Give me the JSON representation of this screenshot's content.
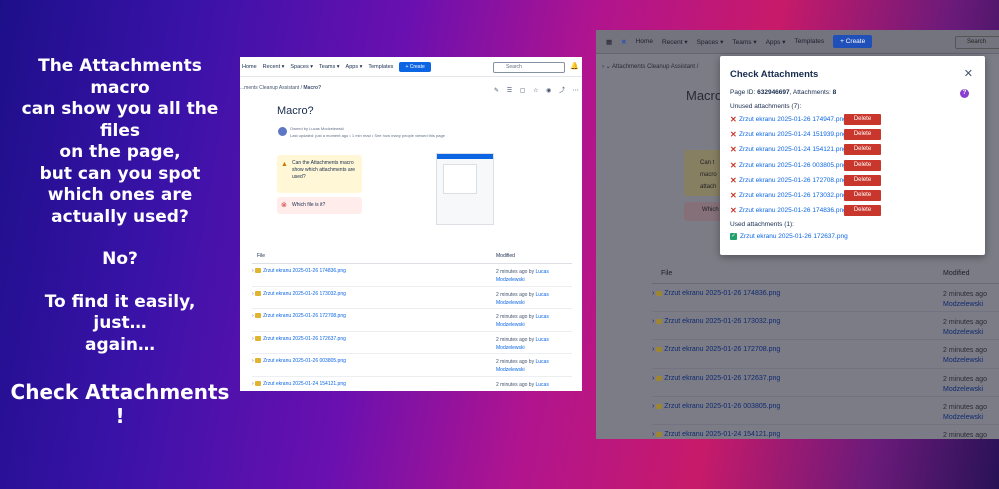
{
  "promo": {
    "lines": [
      "The Attachments macro",
      "can show you all the files",
      "on the page,",
      "but can you spot",
      "which ones are",
      "actually used?",
      "",
      "No?",
      "",
      "To find it easily,",
      "just…",
      "again…"
    ],
    "cta": "Check Attachments !"
  },
  "left": {
    "nav": [
      "Home",
      "Recent ▾",
      "Spaces ▾",
      "Teams ▾",
      "Apps ▾",
      "Templates"
    ],
    "create": "+ Create",
    "search": "Search",
    "breadcrumb_start": "...ments Cleanup Assistant",
    "breadcrumb_page": "Macro?",
    "title": "Macro?",
    "owned": "Owned by Lucas Modzelewski",
    "updated": "Last updated: just a moment ago • 1 min read • See how many people viewed this page",
    "warning": "Can the Attachments macro show which attachments are used?",
    "error": "Which file is it?",
    "col_file": "File",
    "col_modified": "Modified",
    "rows": [
      {
        "file": "Zrzut ekranu 2025-01-26 174836.png",
        "when": "2 minutes ago by",
        "who1": "Lucas",
        "who2": "Modzelewski"
      },
      {
        "file": "Zrzut ekranu 2025-01-26 173032.png",
        "when": "2 minutes ago by",
        "who1": "Lucas",
        "who2": "Modzelewski"
      },
      {
        "file": "Zrzut ekranu 2025-01-26 172708.png",
        "when": "2 minutes ago by",
        "who1": "Lucas",
        "who2": "Modzelewski"
      },
      {
        "file": "Zrzut ekranu 2025-01-26 172637.png",
        "when": "2 minutes ago by",
        "who1": "Lucas",
        "who2": "Modzelewski"
      },
      {
        "file": "Zrzut ekranu 2025-01-26 003805.png",
        "when": "2 minutes ago by",
        "who1": "Lucas",
        "who2": "Modzelewski"
      },
      {
        "file": "Zrzut ekranu 2025-01-24 154121.png",
        "when": "2 minutes ago by",
        "who1": "Lucas",
        "who2": ""
      }
    ]
  },
  "right": {
    "nav": [
      "Home",
      "Recent ▾",
      "Spaces ▾",
      "Teams ▾",
      "Apps ▾",
      "Templates"
    ],
    "create": "+ Create",
    "search": "Search",
    "breadcrumb": "Attachments Cleanup Assistant /",
    "title": "Macro",
    "warning": "Can t macro attach",
    "error": "Which",
    "col_file": "File",
    "col_modified": "Modified",
    "rows": [
      {
        "file": "Zrzut ekranu 2025-01-26 174836.png",
        "when": "2 minutes ago",
        "who": "Modzelewski"
      },
      {
        "file": "Zrzut ekranu 2025-01-26 173032.png",
        "when": "2 minutes ago",
        "who": "Modzelewski"
      },
      {
        "file": "Zrzut ekranu 2025-01-26 172708.png",
        "when": "2 minutes ago",
        "who": "Modzelewski"
      },
      {
        "file": "Zrzut ekranu 2025-01-26 172637.png",
        "when": "2 minutes ago",
        "who": "Modzelewski"
      },
      {
        "file": "Zrzut ekranu 2025-01-26 003805.png",
        "when": "2 minutes ago",
        "who": "Modzelewski"
      },
      {
        "file": "Zrzut ekranu 2025-01-24 154121.png",
        "when": "2 minutes ago",
        "who": "Modzelewski"
      }
    ]
  },
  "modal": {
    "title": "Check Attachments",
    "page_id_label": "Page ID:",
    "page_id": "632946697",
    "attachments_label": ", Attachments:",
    "attachments_count": "8",
    "unused_label": "Unused attachments (7):",
    "unused": [
      "Zrzut ekranu 2025-01-26 174947.png",
      "Zrzut ekranu 2025-01-24 151939.png",
      "Zrzut ekranu 2025-01-24 154121.png",
      "Zrzut ekranu 2025-01-26 003805.png",
      "Zrzut ekranu 2025-01-26 172708.png",
      "Zrzut ekranu 2025-01-26 173032.png",
      "Zrzut ekranu 2025-01-26 174836.png"
    ],
    "delete_label": "Delete",
    "used_label": "Used attachments (1):",
    "used": [
      "Zrzut ekranu 2025-01-26 172637.png"
    ],
    "close": "✕",
    "help": "?"
  },
  "colors": {
    "accent": "#0c66e4",
    "delete": "#c9372c",
    "used_check": "#22a06b"
  }
}
